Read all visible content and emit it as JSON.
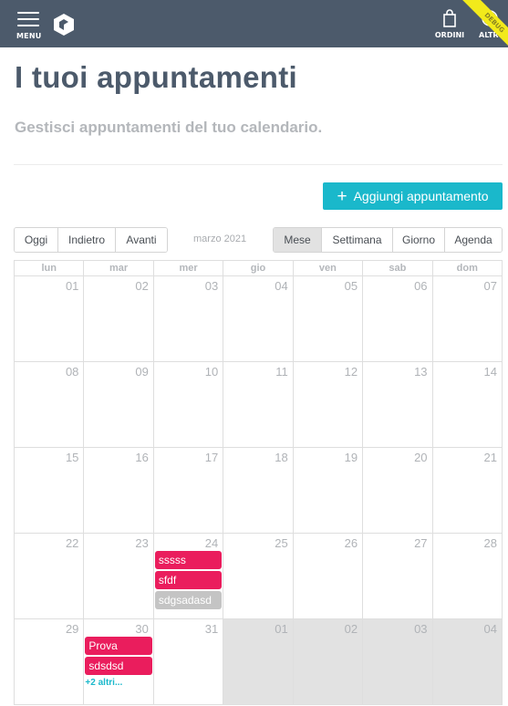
{
  "topbar": {
    "menu_label": "MENU",
    "orders_label": "ORDINI",
    "more_label": "ALTRO",
    "ribbon_text": "DEBUG",
    "colors": {
      "bar": "#4c5a6b",
      "ribbon": "#f2ea1b"
    },
    "icons": {
      "menu": "hamburger-icon",
      "logo": "logo-icon",
      "orders": "shopping-bag-icon",
      "more": "more-dots-icon"
    }
  },
  "header": {
    "title": "I tuoi appuntamenti",
    "subtitle": "Gestisci appuntamenti del tuo calendario."
  },
  "actions": {
    "add_label": "Aggiungi appuntamento",
    "add_icon": "plus-icon",
    "accent": "#1ab8cb"
  },
  "toolbar": {
    "nav": [
      "Oggi",
      "Indietro",
      "Avanti"
    ],
    "title": "marzo 2021",
    "views": [
      "Mese",
      "Settimana",
      "Giorno",
      "Agenda"
    ],
    "active_view": "Mese"
  },
  "calendar": {
    "weekdays": [
      "lun",
      "mar",
      "mer",
      "gio",
      "ven",
      "sab",
      "dom"
    ],
    "weeks": [
      [
        {
          "d": "01"
        },
        {
          "d": "02"
        },
        {
          "d": "03"
        },
        {
          "d": "04"
        },
        {
          "d": "05"
        },
        {
          "d": "06"
        },
        {
          "d": "07"
        }
      ],
      [
        {
          "d": "08"
        },
        {
          "d": "09"
        },
        {
          "d": "10"
        },
        {
          "d": "11"
        },
        {
          "d": "12"
        },
        {
          "d": "13"
        },
        {
          "d": "14"
        }
      ],
      [
        {
          "d": "15"
        },
        {
          "d": "16"
        },
        {
          "d": "17"
        },
        {
          "d": "18"
        },
        {
          "d": "19"
        },
        {
          "d": "20"
        },
        {
          "d": "21"
        }
      ],
      [
        {
          "d": "22"
        },
        {
          "d": "23"
        },
        {
          "d": "24",
          "events": [
            {
              "title": "sssss",
              "color": "#ea1d5d"
            },
            {
              "title": "sfdf",
              "color": "#ea1d5d"
            },
            {
              "title": "sdgsadasd",
              "color": "#c4c4c4"
            }
          ]
        },
        {
          "d": "25"
        },
        {
          "d": "26"
        },
        {
          "d": "27"
        },
        {
          "d": "28"
        }
      ],
      [
        {
          "d": "29"
        },
        {
          "d": "30",
          "events": [
            {
              "title": "Prova",
              "color": "#ea1d5d"
            },
            {
              "title": "sdsdsd",
              "color": "#ea1d5d"
            }
          ],
          "more": "+2 altri..."
        },
        {
          "d": "31"
        },
        {
          "d": "01",
          "other": true
        },
        {
          "d": "02",
          "other": true
        },
        {
          "d": "03",
          "other": true
        },
        {
          "d": "04",
          "other": true
        }
      ]
    ]
  }
}
